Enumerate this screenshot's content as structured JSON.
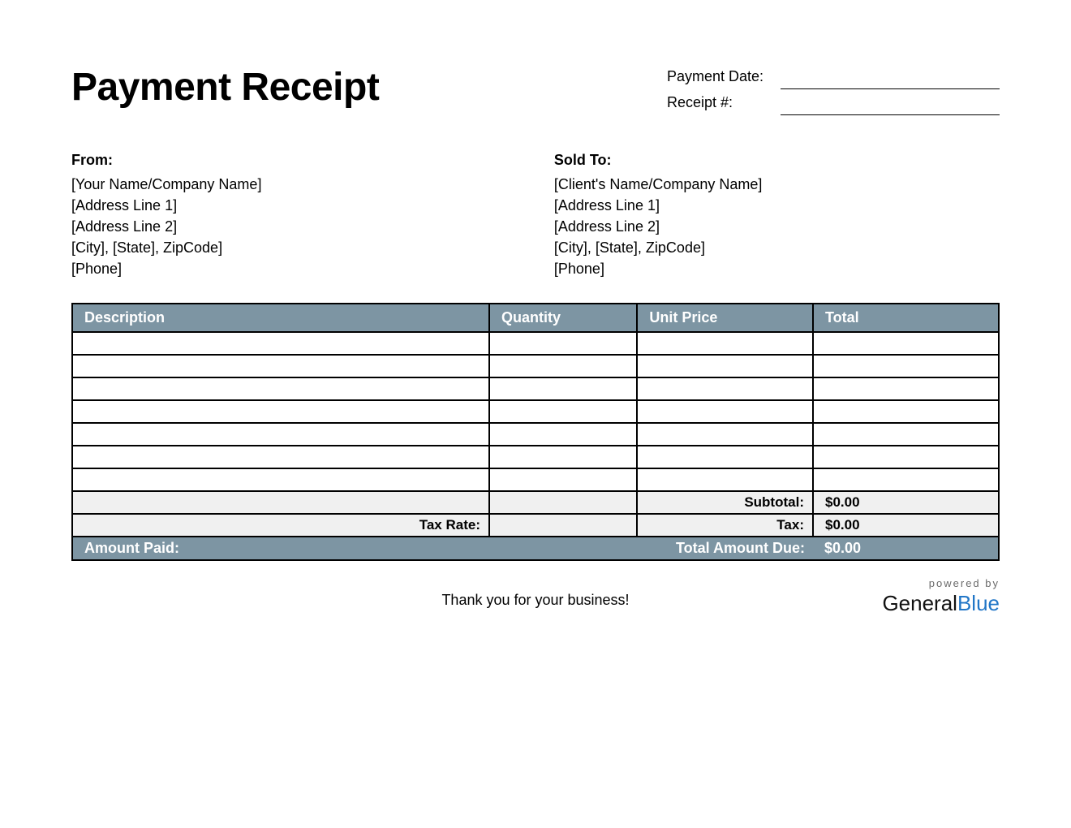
{
  "title": "Payment Receipt",
  "meta": {
    "payment_date_label": "Payment Date:",
    "payment_date_value": "",
    "receipt_no_label": "Receipt #:",
    "receipt_no_value": ""
  },
  "from": {
    "heading": "From:",
    "lines": [
      "[Your Name/Company Name]",
      "[Address Line 1]",
      "[Address Line 2]",
      "[City], [State], ZipCode]",
      "[Phone]"
    ]
  },
  "sold_to": {
    "heading": "Sold To:",
    "lines": [
      "[Client's Name/Company Name]",
      "[Address Line 1]",
      "[Address Line 2]",
      "[City], [State], ZipCode]",
      "[Phone]"
    ]
  },
  "table": {
    "headers": {
      "description": "Description",
      "quantity": "Quantity",
      "unit_price": "Unit Price",
      "total": "Total"
    },
    "rows": [
      {
        "description": "",
        "quantity": "",
        "unit_price": "",
        "total": ""
      },
      {
        "description": "",
        "quantity": "",
        "unit_price": "",
        "total": ""
      },
      {
        "description": "",
        "quantity": "",
        "unit_price": "",
        "total": ""
      },
      {
        "description": "",
        "quantity": "",
        "unit_price": "",
        "total": ""
      },
      {
        "description": "",
        "quantity": "",
        "unit_price": "",
        "total": ""
      },
      {
        "description": "",
        "quantity": "",
        "unit_price": "",
        "total": ""
      },
      {
        "description": "",
        "quantity": "",
        "unit_price": "",
        "total": ""
      }
    ],
    "summary": {
      "subtotal_label": "Subtotal:",
      "subtotal_value": "$0.00",
      "tax_rate_label": "Tax Rate:",
      "tax_rate_value": "",
      "tax_label": "Tax:",
      "tax_value": "$0.00",
      "amount_paid_label": "Amount Paid:",
      "amount_paid_value": "",
      "total_due_label": "Total Amount Due:",
      "total_due_value": "$0.00"
    }
  },
  "footer": {
    "thanks": "Thank you for your business!",
    "powered_by": "powered by",
    "brand_part1": "General",
    "brand_part2": "Blue"
  },
  "colors": {
    "header_bg": "#7d95a3",
    "summary_bg": "#f0f0f0",
    "brand_blue": "#2176c7"
  }
}
